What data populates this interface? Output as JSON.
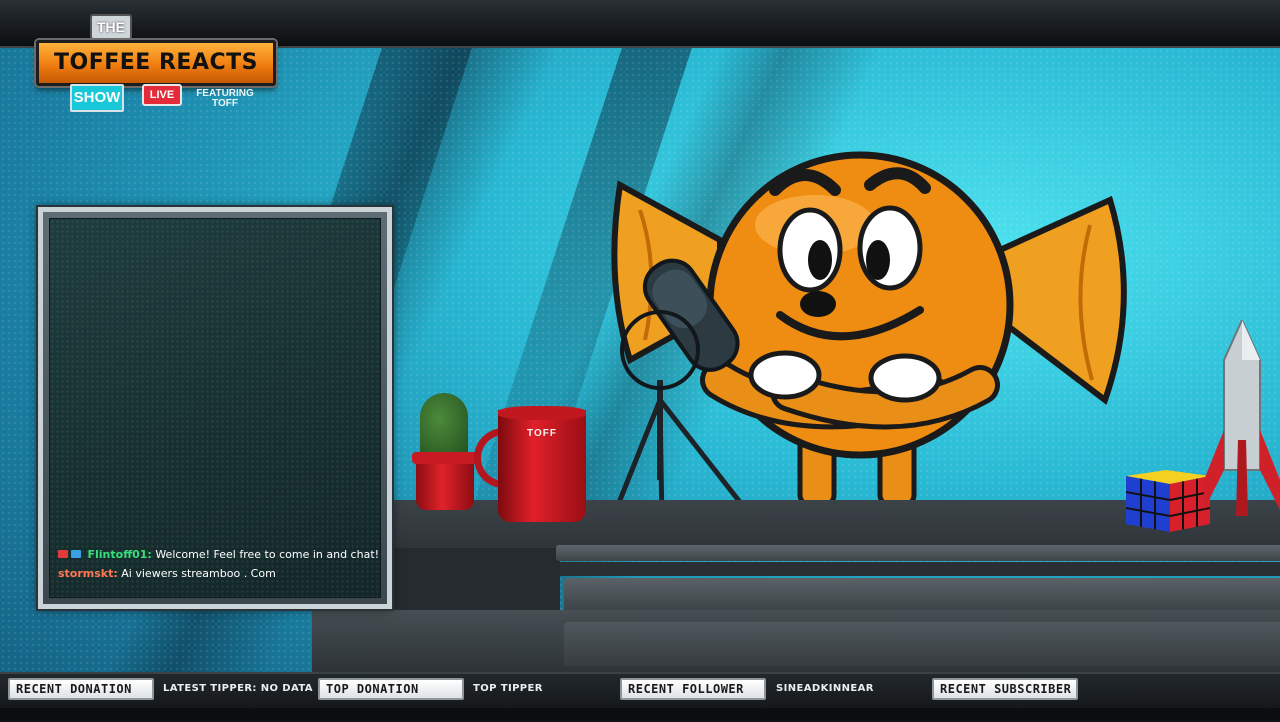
{
  "logo": {
    "the": "THE",
    "main": "TOFFEE REACTS",
    "show": "SHOW",
    "live": "LIVE",
    "featuring": "FEATURING",
    "featuring_name": "TOFF"
  },
  "chat": {
    "messages": [
      {
        "user": "Flintoff01:",
        "text": "Welcome! Feel free to come in and chat!",
        "user_color": "#35e07a"
      },
      {
        "user": "stormskt:",
        "text": "Ai viewers streamboo . Com",
        "user_color": "#ff7a52"
      }
    ]
  },
  "props": {
    "mug_label": "TOFF"
  },
  "bottom_bar": {
    "recent_donation_label": "RECENT DONATION",
    "latest_tipper_label": "LATEST TIPPER: NO DATA",
    "top_donation_label": "TOP DONATION",
    "top_tipper_label": "TOP TIPPER",
    "recent_follower_label": "RECENT FOLLOWER",
    "recent_follower_value": "SINEADKINNEAR",
    "recent_subscriber_label": "RECENT SUBSCRIBER"
  },
  "colors": {
    "accent_orange": "#f07d10",
    "accent_cyan": "#19c8d8",
    "live_red": "#e32b3a",
    "bar_dark": "#171b1f"
  },
  "icons": [
    "chat-badge-icon",
    "cactus-icon",
    "mug-icon",
    "microphone-icon",
    "toffee-mascot-icon",
    "rubiks-cube-icon",
    "rocket-icon"
  ]
}
